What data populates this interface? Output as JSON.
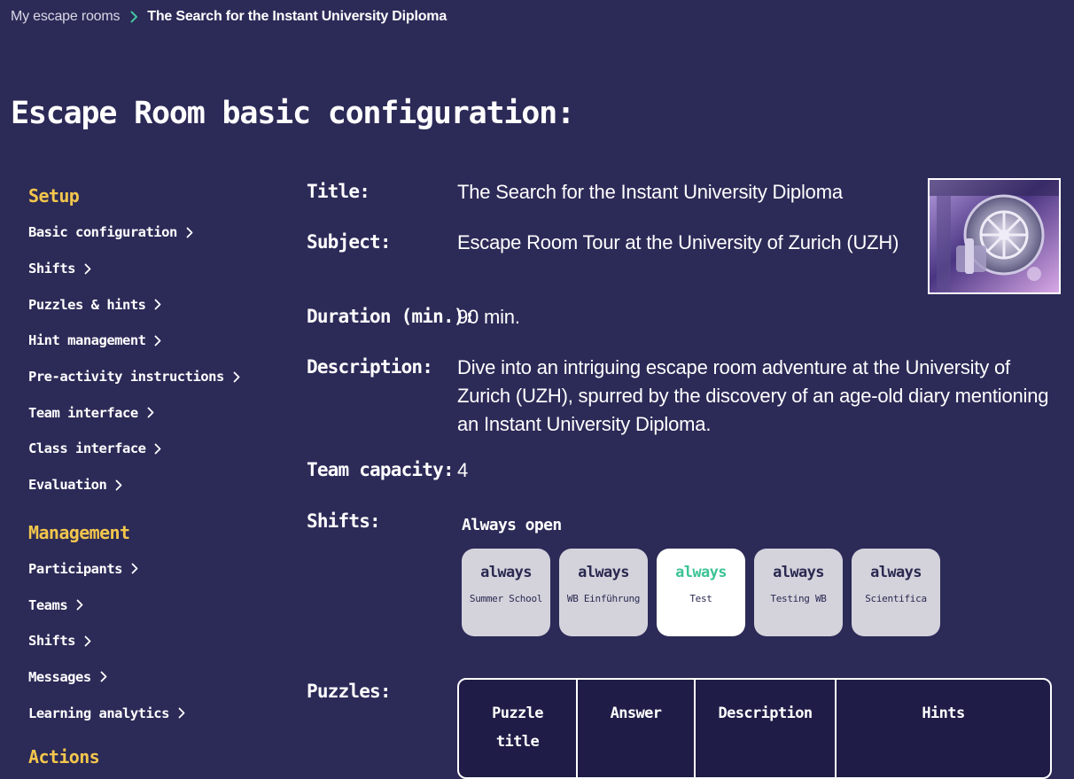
{
  "breadcrumb": {
    "parent": "My escape rooms",
    "current": "The Search for the Instant University Diploma"
  },
  "page_title": "Escape Room basic configuration:",
  "sidebar": {
    "sections": [
      {
        "title": "Setup",
        "items": [
          "Basic configuration",
          "Shifts",
          "Puzzles & hints",
          "Hint management",
          "Pre-activity instructions",
          "Team interface",
          "Class interface",
          "Evaluation"
        ]
      },
      {
        "title": "Management",
        "items": [
          "Participants",
          "Teams",
          "Shifts",
          "Messages",
          "Learning analytics"
        ]
      },
      {
        "title": "Actions",
        "items": []
      }
    ]
  },
  "details": {
    "title_label": "Title:",
    "title_value": "The Search for the Instant University Diploma",
    "subject_label": "Subject:",
    "subject_value": "Escape Room Tour at the University of Zurich (UZH)",
    "duration_label": "Duration (min.):",
    "duration_value": "90 min.",
    "description_label": "Description:",
    "description_value": "Dive into an intriguing escape room adventure at the University of Zurich (UZH), spurred by the discovery of an age-old diary mentioning an Instant University Diploma.",
    "capacity_label": "Team capacity:",
    "capacity_value": "4",
    "shifts_label": "Shifts:",
    "shifts_subtitle": "Always open",
    "puzzles_label": "Puzzles:"
  },
  "shifts": [
    {
      "when": "always",
      "name": "Summer School",
      "active": false
    },
    {
      "when": "always",
      "name": "WB Einführung",
      "active": false
    },
    {
      "when": "always",
      "name": "Test",
      "active": true
    },
    {
      "when": "always",
      "name": "Testing WB",
      "active": false
    },
    {
      "when": "always",
      "name": "Scientifica",
      "active": false
    }
  ],
  "puzzles_table": {
    "headers": [
      "Puzzle title",
      "Answer",
      "Description",
      "Hints"
    ]
  },
  "icons": {
    "breadcrumb_separator": "chevron-right-icon",
    "sidebar_chevron": "chevron-right-icon"
  },
  "colors": {
    "background": "#2c2a57",
    "section_title": "#f3c64c",
    "accent_green": "#3cc395",
    "card": "#d4d3dc",
    "table_bg": "#1f1d47"
  }
}
